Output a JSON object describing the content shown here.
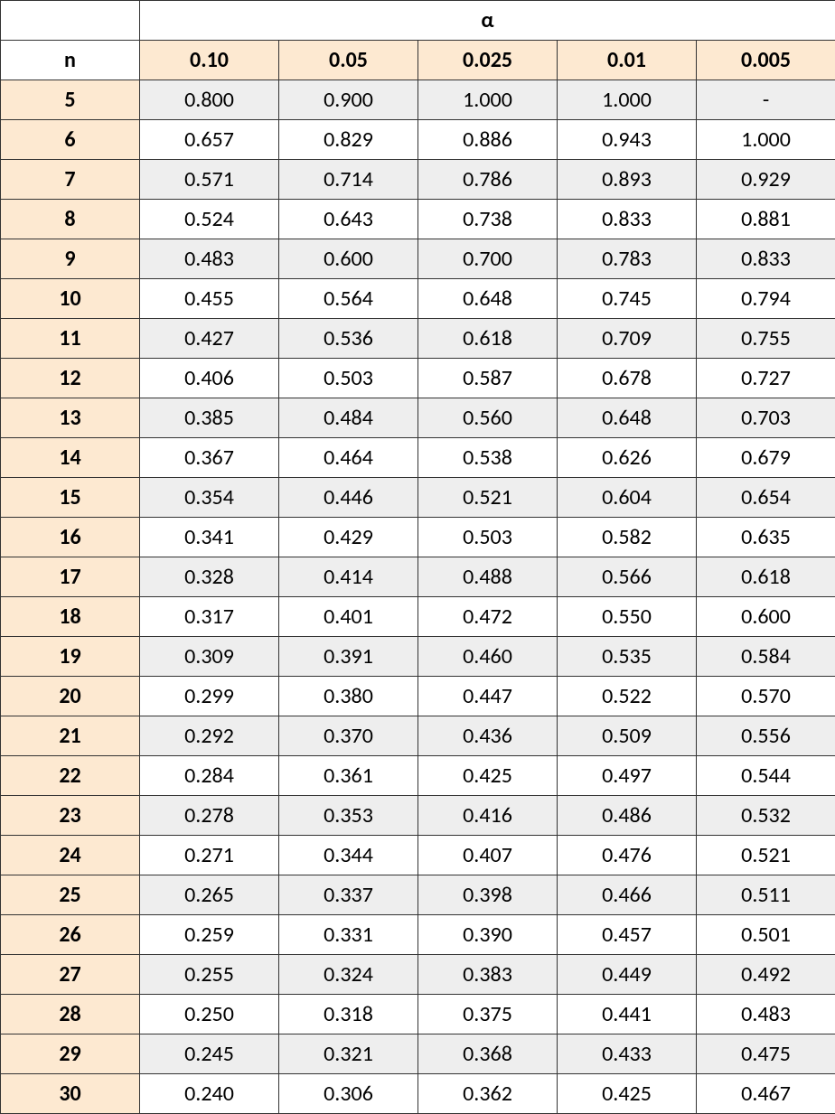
{
  "chart_data": {
    "type": "table",
    "header_symbol": "α",
    "n_label": "n",
    "alpha_levels": [
      "0.10",
      "0.05",
      "0.025",
      "0.01",
      "0.005"
    ],
    "rows": [
      {
        "n": "5",
        "vals": [
          "0.800",
          "0.900",
          "1.000",
          "1.000",
          "-"
        ]
      },
      {
        "n": "6",
        "vals": [
          "0.657",
          "0.829",
          "0.886",
          "0.943",
          "1.000"
        ]
      },
      {
        "n": "7",
        "vals": [
          "0.571",
          "0.714",
          "0.786",
          "0.893",
          "0.929"
        ]
      },
      {
        "n": "8",
        "vals": [
          "0.524",
          "0.643",
          "0.738",
          "0.833",
          "0.881"
        ]
      },
      {
        "n": "9",
        "vals": [
          "0.483",
          "0.600",
          "0.700",
          "0.783",
          "0.833"
        ]
      },
      {
        "n": "10",
        "vals": [
          "0.455",
          "0.564",
          "0.648",
          "0.745",
          "0.794"
        ]
      },
      {
        "n": "11",
        "vals": [
          "0.427",
          "0.536",
          "0.618",
          "0.709",
          "0.755"
        ]
      },
      {
        "n": "12",
        "vals": [
          "0.406",
          "0.503",
          "0.587",
          "0.678",
          "0.727"
        ]
      },
      {
        "n": "13",
        "vals": [
          "0.385",
          "0.484",
          "0.560",
          "0.648",
          "0.703"
        ]
      },
      {
        "n": "14",
        "vals": [
          "0.367",
          "0.464",
          "0.538",
          "0.626",
          "0.679"
        ]
      },
      {
        "n": "15",
        "vals": [
          "0.354",
          "0.446",
          "0.521",
          "0.604",
          "0.654"
        ]
      },
      {
        "n": "16",
        "vals": [
          "0.341",
          "0.429",
          "0.503",
          "0.582",
          "0.635"
        ]
      },
      {
        "n": "17",
        "vals": [
          "0.328",
          "0.414",
          "0.488",
          "0.566",
          "0.618"
        ]
      },
      {
        "n": "18",
        "vals": [
          "0.317",
          "0.401",
          "0.472",
          "0.550",
          "0.600"
        ]
      },
      {
        "n": "19",
        "vals": [
          "0.309",
          "0.391",
          "0.460",
          "0.535",
          "0.584"
        ]
      },
      {
        "n": "20",
        "vals": [
          "0.299",
          "0.380",
          "0.447",
          "0.522",
          "0.570"
        ]
      },
      {
        "n": "21",
        "vals": [
          "0.292",
          "0.370",
          "0.436",
          "0.509",
          "0.556"
        ]
      },
      {
        "n": "22",
        "vals": [
          "0.284",
          "0.361",
          "0.425",
          "0.497",
          "0.544"
        ]
      },
      {
        "n": "23",
        "vals": [
          "0.278",
          "0.353",
          "0.416",
          "0.486",
          "0.532"
        ]
      },
      {
        "n": "24",
        "vals": [
          "0.271",
          "0.344",
          "0.407",
          "0.476",
          "0.521"
        ]
      },
      {
        "n": "25",
        "vals": [
          "0.265",
          "0.337",
          "0.398",
          "0.466",
          "0.511"
        ]
      },
      {
        "n": "26",
        "vals": [
          "0.259",
          "0.331",
          "0.390",
          "0.457",
          "0.501"
        ]
      },
      {
        "n": "27",
        "vals": [
          "0.255",
          "0.324",
          "0.383",
          "0.449",
          "0.492"
        ]
      },
      {
        "n": "28",
        "vals": [
          "0.250",
          "0.318",
          "0.375",
          "0.441",
          "0.483"
        ]
      },
      {
        "n": "29",
        "vals": [
          "0.245",
          "0.321",
          "0.368",
          "0.433",
          "0.475"
        ]
      },
      {
        "n": "30",
        "vals": [
          "0.240",
          "0.306",
          "0.362",
          "0.425",
          "0.467"
        ]
      }
    ]
  }
}
